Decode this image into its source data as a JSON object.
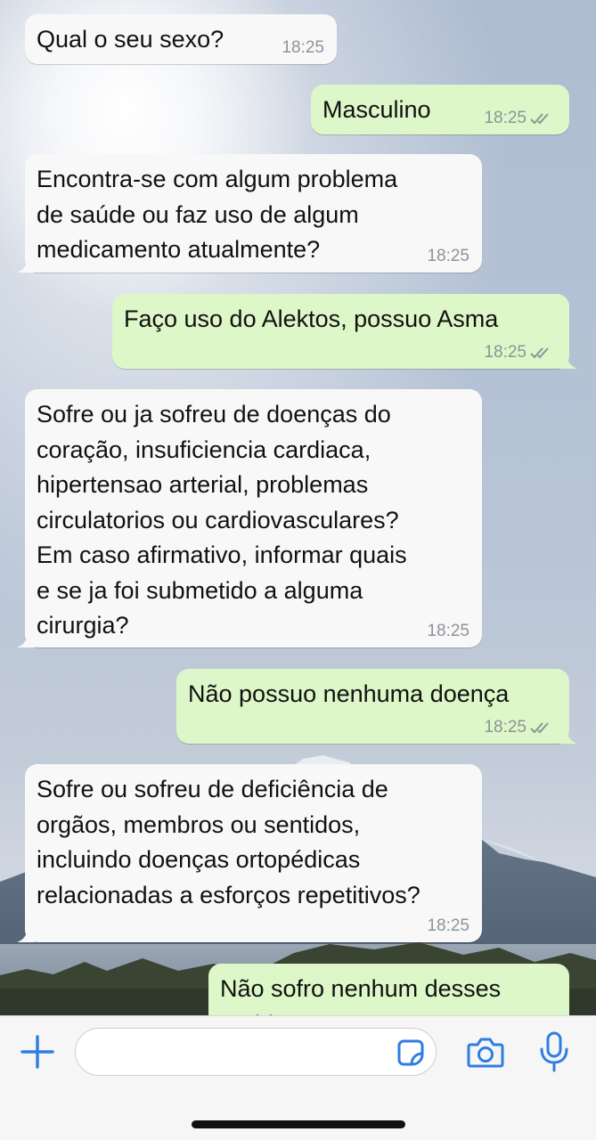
{
  "messages": [
    {
      "direction": "incoming",
      "text": "Qual o seu sexo?",
      "time": "18:25"
    },
    {
      "direction": "outgoing",
      "text": "Masculino",
      "time": "18:25",
      "status": "delivered"
    },
    {
      "direction": "incoming",
      "text": "Encontra-se com algum problema\nde saúde ou faz uso de algum\nmedicamento atualmente?",
      "time": "18:25"
    },
    {
      "direction": "outgoing",
      "text": "Faço uso do Alektos, possuo Asma",
      "time": "18:25",
      "status": "delivered"
    },
    {
      "direction": "incoming",
      "text": "Sofre ou ja sofreu de doenças do\ncoração, insuficiencia cardiaca,\nhipertensao arterial, problemas\ncirculatorios ou cardiovasculares?\nEm caso afirmativo, informar quais\ne se ja foi submetido a alguma\ncirurgia?",
      "time": "18:25"
    },
    {
      "direction": "outgoing",
      "text": "Não possuo nenhuma doença",
      "time": "18:25",
      "status": "delivered"
    },
    {
      "direction": "incoming",
      "text": "Sofre ou sofreu de deficiência de\norgãos, membros ou sentidos,\nincluindo doenças ortopédicas\nrelacionadas a esforços repetitivos?",
      "time": "18:25"
    },
    {
      "direction": "outgoing",
      "text": "Não sofro nenhum desses\nproblemas",
      "time": "",
      "status": ""
    }
  ],
  "composer": {
    "placeholder": "",
    "icons": [
      "plus-icon",
      "sticker-icon",
      "camera-icon",
      "microphone-icon"
    ]
  },
  "colors": {
    "incoming_bubble": "#f8f8f8",
    "outgoing_bubble": "#ddf7c8",
    "accent": "#2f7de1",
    "timestamp": "#8e9399"
  }
}
